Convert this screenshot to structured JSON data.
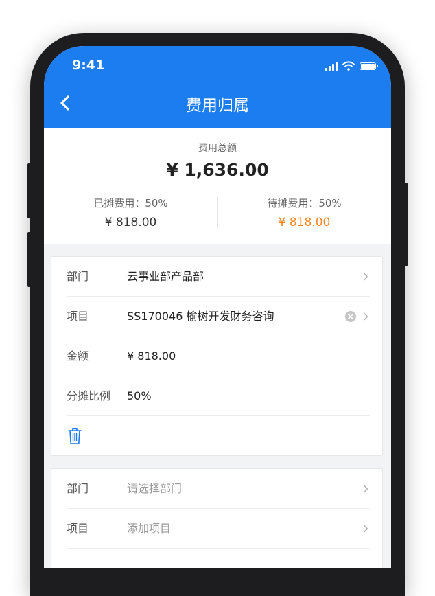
{
  "status_bar": {
    "time": "9:41"
  },
  "nav": {
    "title": "费用归属"
  },
  "summary": {
    "total_label": "费用总额",
    "total_value": "¥ 1,636.00",
    "allocated": {
      "label": "已摊费用：50%",
      "value": "¥ 818.00"
    },
    "pending": {
      "label": "待摊费用：50%",
      "value": "¥ 818.00",
      "color": "#f5851f"
    }
  },
  "card1": {
    "rows": [
      {
        "key": "部门",
        "value": "云事业部产品部"
      },
      {
        "key": "项目",
        "value": "SS170046 榆树开发财务咨询"
      },
      {
        "key": "金额",
        "value": "¥ 818.00"
      },
      {
        "key": "分摊比例",
        "value": "50%"
      }
    ]
  },
  "card2": {
    "rows": [
      {
        "key": "部门",
        "placeholder": "请选择部门"
      },
      {
        "key": "项目",
        "placeholder": "添加项目"
      }
    ]
  },
  "colors": {
    "primary": "#1c7df1",
    "accent": "#f5851f"
  }
}
